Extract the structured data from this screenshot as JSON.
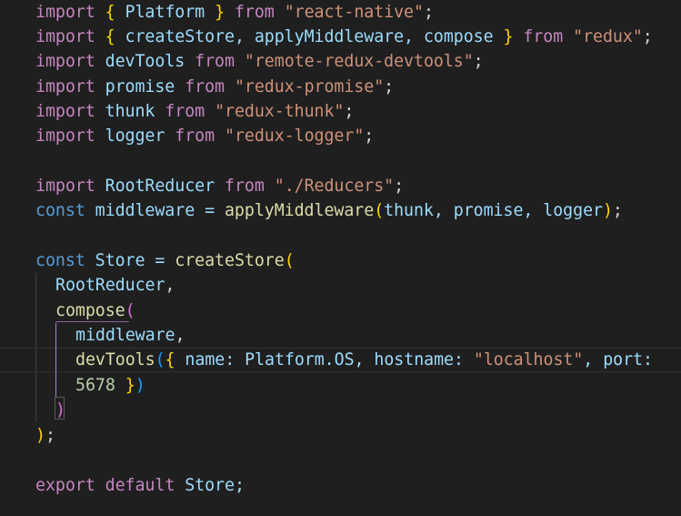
{
  "editor": {
    "lines": [
      {
        "id": "l1",
        "tokens": [
          "import",
          " ",
          "{",
          " Platform ",
          "}",
          " from ",
          "\"react-native\"",
          ";"
        ]
      },
      {
        "id": "l2",
        "tokens": [
          "import",
          " ",
          "{",
          " createStore, applyMiddleware, compose ",
          "}",
          " from ",
          "\"redux\"",
          ";"
        ]
      },
      {
        "id": "l3",
        "tokens": [
          "import",
          " devTools ",
          "from",
          " ",
          "\"remote-redux-devtools\"",
          ";"
        ]
      },
      {
        "id": "l4",
        "tokens": [
          "import",
          " promise ",
          "from",
          " ",
          "\"redux-promise\"",
          ";"
        ]
      },
      {
        "id": "l5",
        "tokens": [
          "import",
          " thunk ",
          "from",
          " ",
          "\"redux-thunk\"",
          ";"
        ]
      },
      {
        "id": "l6",
        "tokens": [
          "import",
          " logger ",
          "from",
          " ",
          "\"redux-logger\"",
          ";"
        ]
      },
      {
        "id": "l8",
        "tokens": [
          "import",
          " RootReducer ",
          "from",
          " ",
          "\"./Reducers\"",
          ";"
        ]
      },
      {
        "id": "l9",
        "tokens": [
          "const",
          " middleware = ",
          "applyMiddleware",
          "(",
          "thunk, promise, logger",
          ")",
          ";"
        ]
      },
      {
        "id": "l11",
        "tokens": [
          "const",
          " Store = ",
          "createStore",
          "("
        ]
      },
      {
        "id": "l12",
        "tokens": [
          "RootReducer",
          ","
        ]
      },
      {
        "id": "l13",
        "tokens": [
          "compose",
          "("
        ]
      },
      {
        "id": "l14",
        "tokens": [
          "middleware",
          ","
        ]
      },
      {
        "id": "l15",
        "tokens": [
          "devTools",
          "(",
          "{",
          " name: Platform.OS, hostname: ",
          "\"localhost\"",
          ", port:"
        ]
      },
      {
        "id": "l16",
        "tokens": [
          "5678",
          " ",
          "}",
          ")"
        ]
      },
      {
        "id": "l17",
        "tokens": [
          ")"
        ]
      },
      {
        "id": "l18",
        "tokens": [
          ")",
          ";"
        ]
      },
      {
        "id": "l20",
        "tokens": [
          "export",
          " ",
          "default",
          " Store;"
        ]
      }
    ]
  },
  "colors": {
    "background": "#1f1f1f",
    "keyword_control": "#c586c0",
    "keyword_storage": "#569cd6",
    "variable": "#9cdcfe",
    "function": "#dcdcaa",
    "string": "#ce9178",
    "number": "#b5cea8",
    "bracket_level1": "#ffd700",
    "bracket_level2": "#da70d6",
    "bracket_level3": "#179fff"
  }
}
